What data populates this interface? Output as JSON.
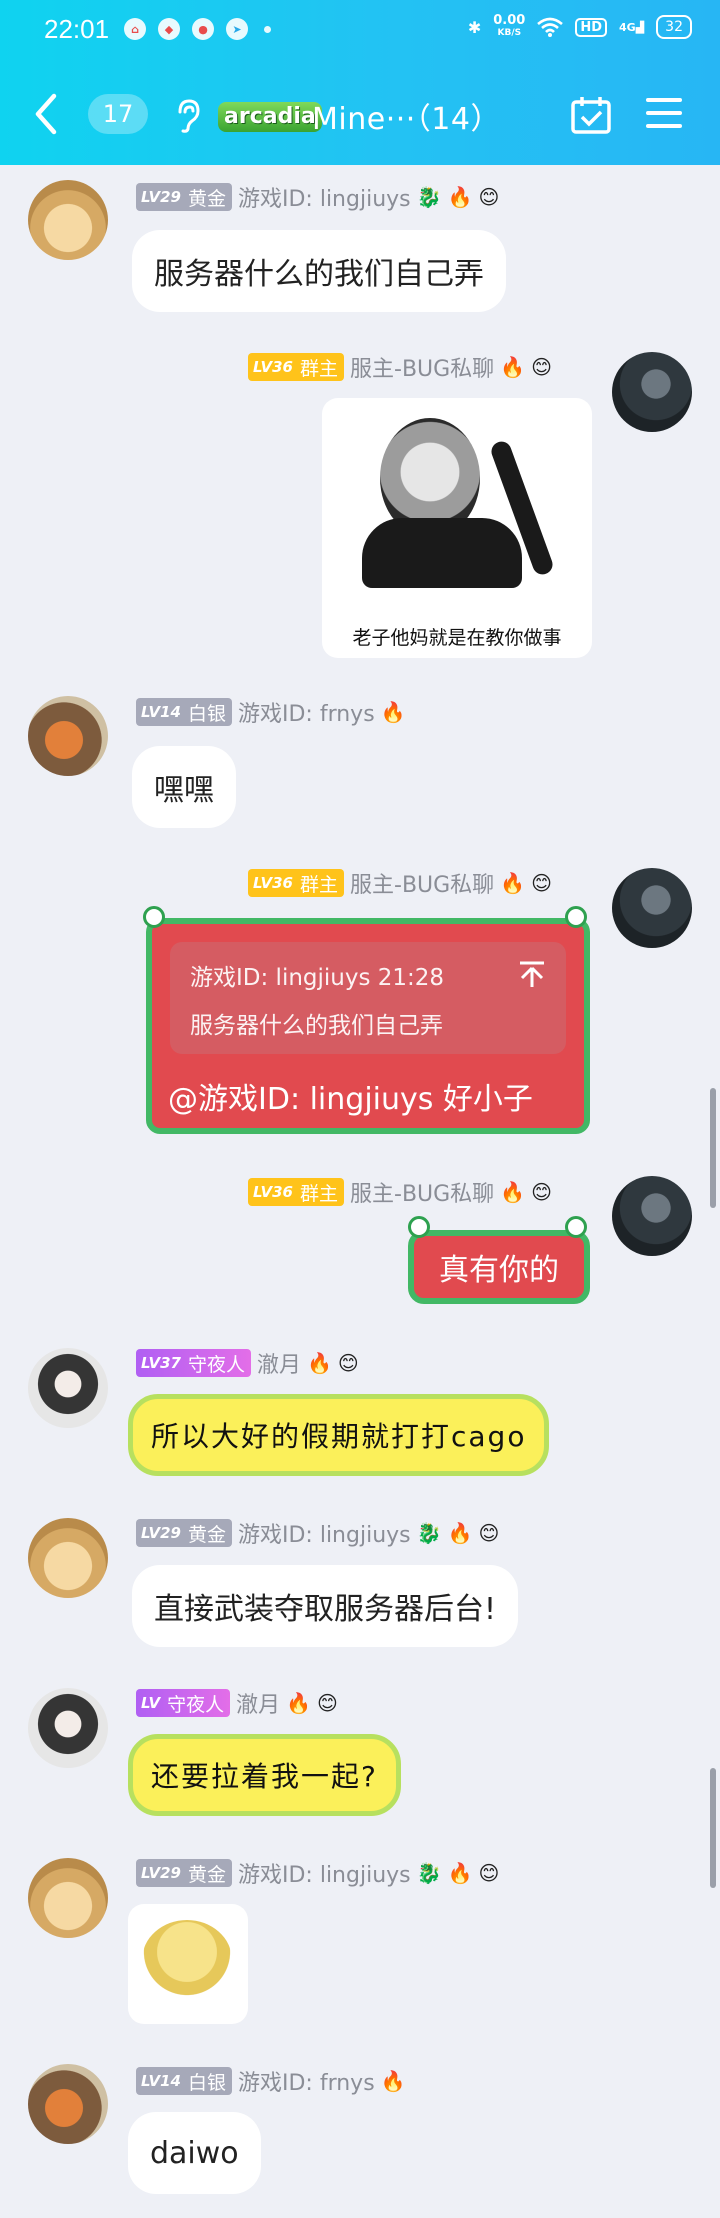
{
  "status_bar": {
    "time": "22:01",
    "net_speed_value": "0.00",
    "net_speed_unit": "KB/S",
    "hd_label": "HD",
    "signal_label": "4G",
    "battery": "32"
  },
  "header": {
    "unread_count": "17",
    "logo_text": "arcadia",
    "title": "Mine···（14）"
  },
  "messages": [
    {
      "level": "LV29",
      "rank": "黄金",
      "sender": "游戏ID:  lingjiuys",
      "text": "服务器什么的我们自己弄"
    },
    {
      "level": "LV36",
      "rank": "群主",
      "sender": "服主-BUG私聊",
      "image_caption": "老子他妈就是在教你做事"
    },
    {
      "level": "LV14",
      "rank": "白银",
      "sender": "游戏ID:  frnys",
      "text": "嘿嘿"
    },
    {
      "level": "LV36",
      "rank": "群主",
      "sender": "服主-BUG私聊",
      "quote_author": "游戏ID:  lingjiuys 21:28",
      "quote_text": "服务器什么的我们自己弄",
      "text": "@游戏ID:  lingjiuys  好小子"
    },
    {
      "level": "LV36",
      "rank": "群主",
      "sender": "服主-BUG私聊",
      "text": "真有你的"
    },
    {
      "level": "LV37",
      "rank": "守夜人",
      "sender": "澈月",
      "text": "所以大好的假期就打打cago"
    },
    {
      "level": "LV29",
      "rank": "黄金",
      "sender": "游戏ID:  lingjiuys",
      "text": "直接武装夺取服务器后台!"
    },
    {
      "level": "LV",
      "rank": "守夜人",
      "sender": "澈月",
      "text": "还要拉着我一起?"
    },
    {
      "level": "LV29",
      "rank": "黄金",
      "sender": "游戏ID:  lingjiuys"
    },
    {
      "level": "LV14",
      "rank": "白银",
      "sender": "游戏ID:  frnys",
      "text": "daiwo"
    }
  ]
}
